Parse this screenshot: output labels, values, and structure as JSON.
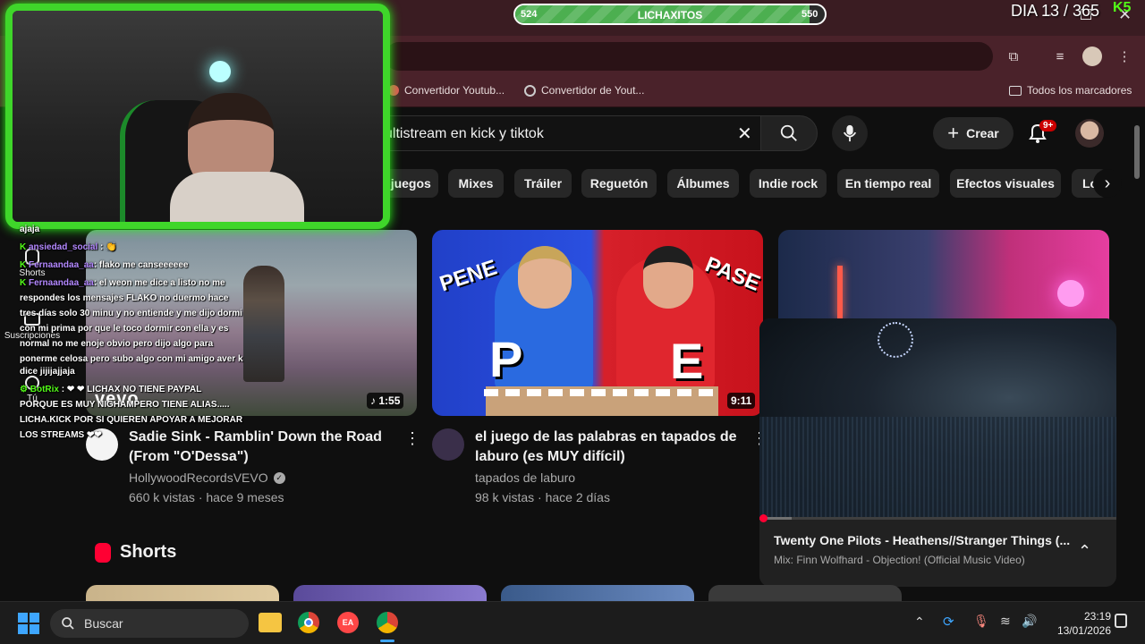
{
  "stream_overlay": {
    "progress_left": "524",
    "progress_label": "LICHAXITOS",
    "progress_right": "550",
    "progress_fraction": 0.95,
    "day_counter": "DIA 13 / 365",
    "kick_logo": "K5"
  },
  "browser": {
    "bookmarks": [
      {
        "label": "Convertidor Youtub..."
      },
      {
        "label": "Convertidor de Yout..."
      }
    ],
    "all_bookmarks": "Todos los marcadores"
  },
  "youtube": {
    "search_value": "ultistream en kick y tiktok",
    "create_label": "Crear",
    "notif_badge": "9+",
    "chips": [
      "ojuegos",
      "Mixes",
      "Tráiler",
      "Reguetón",
      "Álbumes",
      "Indie rock",
      "En tiempo real",
      "Efectos visuales",
      "Lo"
    ],
    "videos": [
      {
        "title_line1": "Sadie Sink - Ramblin' Down the Road",
        "title_line2": "(From \"O'Dessa\")",
        "channel": "HollywoodRecordsVEVO",
        "meta": "660 k vistas · hace 9 meses",
        "duration": "1:55",
        "watermark": "vevo"
      },
      {
        "title_line1": "el juego de las palabras en tapados de",
        "title_line2": "laburo (es MUY difícil)",
        "channel": "tapados de laburo",
        "meta": "98 k vistas · hace 2 días",
        "duration": "9:11",
        "thumb_left_word": "PENE",
        "thumb_right_word": "PASE",
        "thumb_letter_left": "P",
        "thumb_letter_right": "E"
      }
    ],
    "miniplayer": {
      "title": "Twenty One Pilots - Heathens//Stranger Things (...",
      "subtitle": "Mix: Finn Wolfhard - Objection! (Official Music Video)"
    },
    "shorts_label": "Shorts",
    "sidebar_shorts": "Shorts",
    "sidebar_subs": "Suscripciones",
    "sidebar_tu": "Tú"
  },
  "chat": [
    {
      "user": "",
      "text": "ajaja"
    },
    {
      "user": "ansiedad_social",
      "text": " : 👏"
    },
    {
      "user": "Fernaandaa_aa",
      "text": ": flako me canseeeeee"
    },
    {
      "user": "Fernaandaa_aa",
      "text": ": el weon me dice a listo no me"
    },
    {
      "user": "",
      "text": "respondes los mensajes FLAKO no duermo hace"
    },
    {
      "user": "",
      "text": "tres días solo 30 minu y no entiende y me dijo dormi"
    },
    {
      "user": "",
      "text": "con mi prima por que le toco dormir con ella y es"
    },
    {
      "user": "",
      "text": "normal no me enoje obvio pero dijo algo para"
    },
    {
      "user": "",
      "text": "ponerme celosa pero subo algo con mi amigo aver k"
    },
    {
      "user": "",
      "text": "dice jijijajjaja"
    },
    {
      "user": "BotRix",
      "text": " : ❤ ❤ LICHAX NO TIENE PAYPAL"
    },
    {
      "user": "",
      "text": "PORQUE ES MUY NIGHAMPERO TIENE ALIAS....."
    },
    {
      "user": "",
      "text": "LICHA.KICK POR SI QUIEREN APOYAR A MEJORAR"
    },
    {
      "user": "",
      "text": "LOS STREAMS ❤❤"
    }
  ],
  "taskbar": {
    "search_placeholder": "Buscar",
    "time": "23:19",
    "date": "13/01/2026"
  },
  "colors": {
    "accent_green": "#3fd62a",
    "yt_red": "#ff0033",
    "browser_maroon": "#4a222a"
  }
}
